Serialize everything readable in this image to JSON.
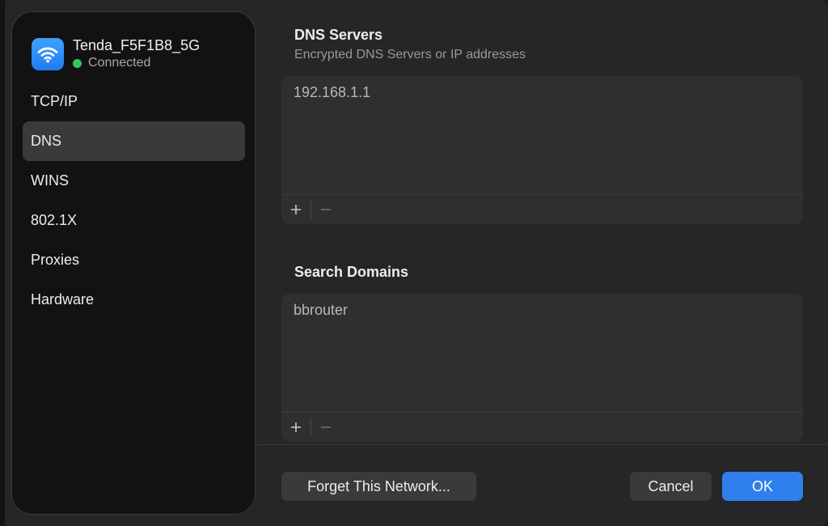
{
  "network": {
    "name": "Tenda_F5F1B8_5G",
    "status": "Connected",
    "icon": "wifi-icon",
    "status_color": "#34c759"
  },
  "sidebar": {
    "items": [
      {
        "label": "TCP/IP",
        "active": false
      },
      {
        "label": "DNS",
        "active": true
      },
      {
        "label": "WINS",
        "active": false
      },
      {
        "label": "802.1X",
        "active": false
      },
      {
        "label": "Proxies",
        "active": false
      },
      {
        "label": "Hardware",
        "active": false
      }
    ]
  },
  "dns_servers": {
    "title": "DNS Servers",
    "subtitle": "Encrypted DNS Servers or IP addresses",
    "entries": [
      "192.168.1.1"
    ]
  },
  "search_domains": {
    "title": "Search Domains",
    "entries": [
      "bbrouter"
    ]
  },
  "footer": {
    "forget_label": "Forget This Network...",
    "cancel_label": "Cancel",
    "ok_label": "OK"
  },
  "colors": {
    "accent": "#2f80ed"
  }
}
